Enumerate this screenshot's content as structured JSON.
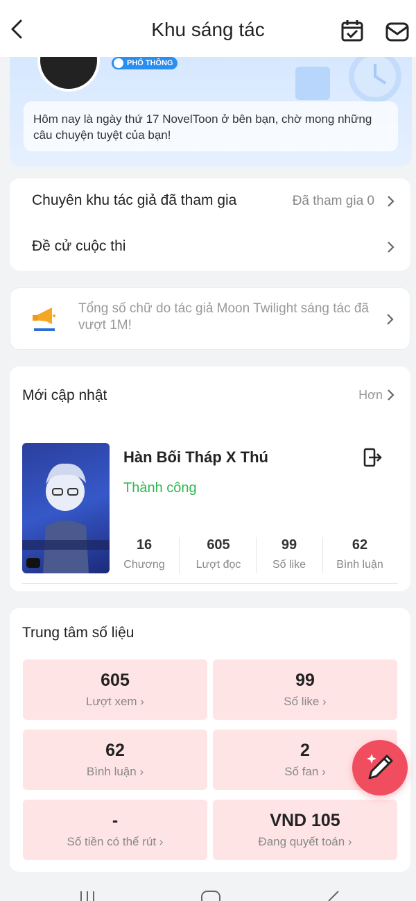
{
  "header": {
    "title": "Khu sáng tác"
  },
  "profile": {
    "badge": "PHỔ THÔNG"
  },
  "tip": "Hôm nay là ngày thứ 17 NovelToon ở bên bạn, chờ mong những câu chuyện tuyệt của bạn!",
  "menu": [
    {
      "label": "Chuyên khu tác giả đã tham gia",
      "value": "Đã tham gia 0"
    },
    {
      "label": "Đề cử cuộc thi",
      "value": ""
    }
  ],
  "announcement": "Tổng số chữ do tác giả Moon Twilight sáng tác đã vượt 1M!",
  "recent": {
    "title": "Mới cập nhật",
    "more": "Hơn",
    "book": {
      "title": "Hàn Bối Tháp X Thú",
      "status": "Thành công",
      "stats": [
        {
          "value": "16",
          "label": "Chương"
        },
        {
          "value": "605",
          "label": "Lượt đọc"
        },
        {
          "value": "99",
          "label": "Số like"
        },
        {
          "value": "62",
          "label": "Bình luận"
        }
      ]
    }
  },
  "data_center": {
    "title": "Trung tâm số liệu",
    "tiles": [
      {
        "value": "605",
        "label": "Lượt xem"
      },
      {
        "value": "99",
        "label": "Số like"
      },
      {
        "value": "62",
        "label": "Bình luận"
      },
      {
        "value": "2",
        "label": "Số fan"
      },
      {
        "value": "-",
        "label": "Số tiền có thể rút"
      },
      {
        "value": "VND 105",
        "label": "Đang quyết toán"
      }
    ]
  },
  "colors": {
    "accent": "#f04d5f",
    "success": "#2db84d",
    "tile_bg": "#ffe4e6",
    "banner": "#d6e8ff"
  }
}
